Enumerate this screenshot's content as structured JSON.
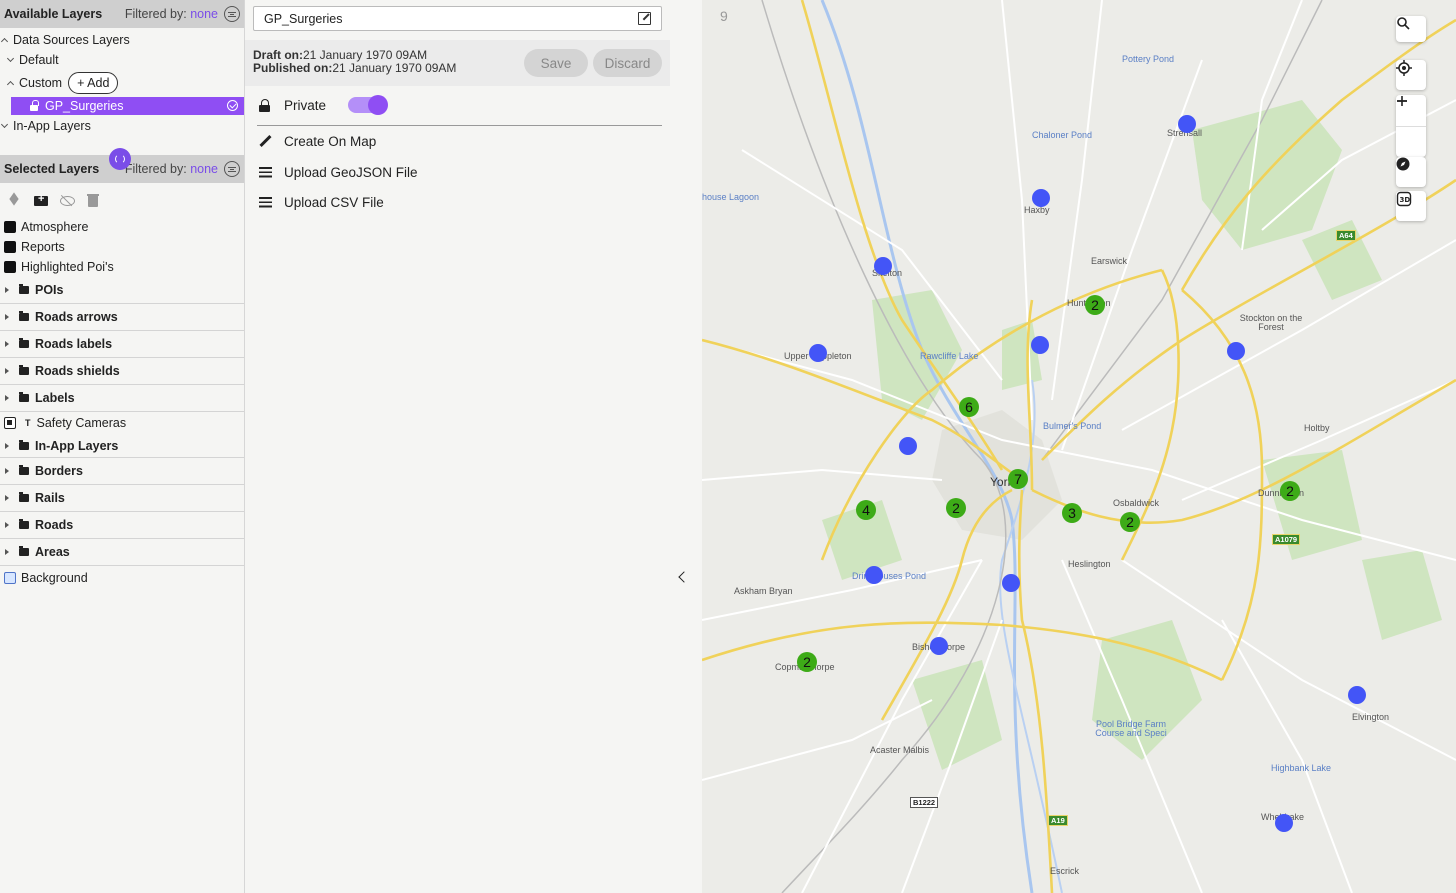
{
  "available_layers": {
    "title": "Available Layers",
    "filter_label": "Filtered by:",
    "filter_value": "none",
    "tree": {
      "data_sources": "Data Sources Layers",
      "default": "Default",
      "custom": "Custom",
      "add_label": "+ Add",
      "selected_layer": "GP_Surgeries",
      "in_app": "In-App Layers"
    }
  },
  "selected_layers": {
    "title": "Selected Layers",
    "filter_label": "Filtered by:",
    "filter_value": "none",
    "items": [
      {
        "label": "Atmosphere"
      },
      {
        "label": "Reports"
      },
      {
        "label": "Highlighted Poi's"
      }
    ],
    "groups_a": [
      "POIs",
      "Roads arrows",
      "Roads labels",
      "Roads shields",
      "Labels"
    ],
    "safety_cameras": "Safety Cameras",
    "groups_b": [
      "In-App Layers",
      "Borders",
      "Rails",
      "Roads",
      "Areas"
    ],
    "background": "Background"
  },
  "layer_editor": {
    "name_value": "GP_Surgeries",
    "draft_label": "Draft on:",
    "draft_value": "21 January 1970 09AM",
    "published_label": "Published on:",
    "published_value": "21 January 1970 09AM",
    "save_label": "Save",
    "discard_label": "Discard",
    "private_label": "Private",
    "actions": [
      "Create On Map",
      "Upload GeoJSON File",
      "Upload CSV File"
    ]
  },
  "map": {
    "places": [
      {
        "name": "Pottery Pond",
        "water": true
      },
      {
        "name": "Chaloner Pond",
        "water": true
      },
      {
        "name": "Strensall",
        "water": false
      },
      {
        "name": "Haxby",
        "water": false
      },
      {
        "name": "house Lagoon",
        "water": true
      },
      {
        "name": "Skelton",
        "water": false
      },
      {
        "name": "Earswick",
        "water": false
      },
      {
        "name": "Huntington",
        "water": false
      },
      {
        "name": "Stockton on the Forest",
        "water": false
      },
      {
        "name": "Upper Poppleton",
        "water": false
      },
      {
        "name": "Rawcliffe Lake",
        "water": true
      },
      {
        "name": "Bulmer's Pond",
        "water": true
      },
      {
        "name": "Holtby",
        "water": false
      },
      {
        "name": "York",
        "water": false
      },
      {
        "name": "Osbaldwick",
        "water": false
      },
      {
        "name": "Dunnington",
        "water": false
      },
      {
        "name": "Heslington",
        "water": false
      },
      {
        "name": "Askham Bryan",
        "water": false
      },
      {
        "name": "Dringhouses Pond",
        "water": true
      },
      {
        "name": "Bishopthorpe",
        "water": false
      },
      {
        "name": "Copmanthorpe",
        "water": false
      },
      {
        "name": "Elvington",
        "water": false
      },
      {
        "name": "Pool Bridge Farm Course and Speci",
        "water": true
      },
      {
        "name": "Highbank Lake",
        "water": true
      },
      {
        "name": "Acaster Malbis",
        "water": false
      },
      {
        "name": "Wheldrake",
        "water": false
      },
      {
        "name": "Escrick",
        "water": false
      }
    ],
    "shields": [
      "A64",
      "A1079",
      "B1222",
      "A19"
    ],
    "clusters": [
      "2",
      "6",
      "7",
      "4",
      "2",
      "3",
      "2",
      "2",
      "2"
    ],
    "attribution_glyph": "9",
    "controls": [
      "search-icon",
      "locate-icon",
      "zoom-in-icon",
      "zoom-out-icon",
      "compass-icon",
      "3d-icon"
    ],
    "colors": {
      "point": "#4355f7",
      "cluster": "#3dab17",
      "accent": "#8f4ef3"
    }
  }
}
